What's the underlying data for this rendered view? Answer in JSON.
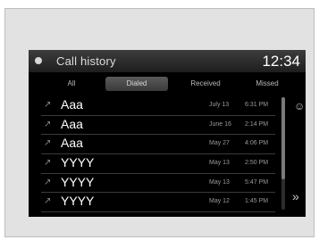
{
  "header": {
    "title": "Call history",
    "clock": "12:34"
  },
  "tabs": [
    {
      "label": "All",
      "active": false
    },
    {
      "label": "Dialed",
      "active": true
    },
    {
      "label": "Received",
      "active": false
    },
    {
      "label": "Missed",
      "active": false
    }
  ],
  "calls": [
    {
      "name": "Aaa",
      "date": "July 13",
      "time": "6:31 PM",
      "icon": "outgoing-call-icon"
    },
    {
      "name": "Aaa",
      "date": "June 16",
      "time": "2:14 PM",
      "icon": "outgoing-call-icon"
    },
    {
      "name": "Aaa",
      "date": "May 27",
      "time": "4:06 PM",
      "icon": "outgoing-call-icon"
    },
    {
      "name": "YYYY",
      "date": "May 13",
      "time": "2:50 PM",
      "icon": "outgoing-call-icon"
    },
    {
      "name": "YYYY",
      "date": "May 13",
      "time": "5:47 PM",
      "icon": "outgoing-call-icon"
    },
    {
      "name": "YYYY",
      "date": "May 12",
      "time": "1:45 PM",
      "icon": "outgoing-call-icon"
    }
  ],
  "scroll": {
    "position": 0
  }
}
